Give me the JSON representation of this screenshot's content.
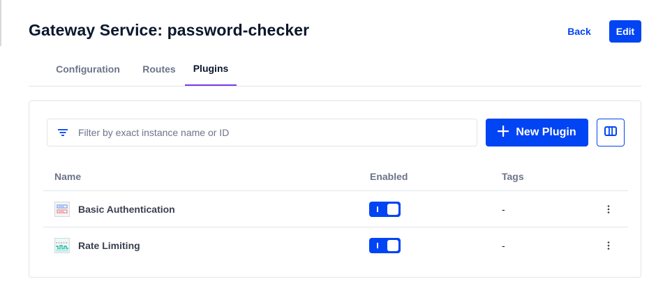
{
  "header": {
    "title": "Gateway Service: password-checker",
    "back_label": "Back",
    "edit_label": "Edit"
  },
  "tabs": [
    {
      "label": "Configuration",
      "active": false
    },
    {
      "label": "Routes",
      "active": false
    },
    {
      "label": "Plugins",
      "active": true
    }
  ],
  "toolbar": {
    "filter_placeholder": "Filter by exact instance name or ID",
    "filter_value": "",
    "new_plugin_label": "New Plugin",
    "icons": {
      "filter": "filter-icon",
      "add": "plus-icon",
      "columns": "table-columns-icon"
    }
  },
  "table": {
    "columns": [
      "Name",
      "Enabled",
      "Tags"
    ],
    "rows": [
      {
        "name": "Basic Authentication",
        "icon": "basic-auth-icon",
        "enabled": true,
        "tags": "-"
      },
      {
        "name": "Rate Limiting",
        "icon": "rate-limiting-icon",
        "enabled": true,
        "tags": "-"
      }
    ]
  },
  "colors": {
    "primary": "#0044f4",
    "active_tab_underline": "#7c3aed",
    "text_dark": "#0b172d",
    "text_muted": "#6c7489",
    "border": "#e0e4ea"
  }
}
